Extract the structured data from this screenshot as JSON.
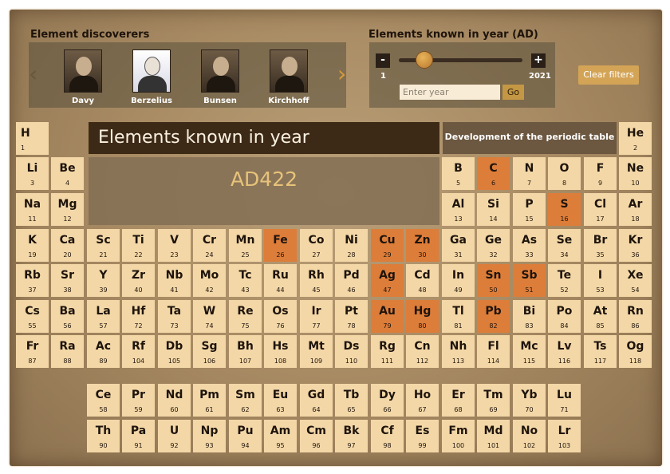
{
  "discoverers": {
    "title": "Element discoverers",
    "items": [
      {
        "name": "Davy",
        "selected": false
      },
      {
        "name": "Berzelius",
        "selected": true
      },
      {
        "name": "Bunsen",
        "selected": false
      },
      {
        "name": "Kirchhoff",
        "selected": false
      }
    ],
    "prev_icon": "chevron-left-icon",
    "next_icon": "chevron-right-icon"
  },
  "year_filter": {
    "title": "Elements known in year (AD)",
    "minus_label": "-",
    "plus_label": "+",
    "min_label": "1",
    "max_label": "2021",
    "input_placeholder": "Enter year",
    "input_value": "",
    "go_label": "Go",
    "slider_value": 422
  },
  "clear_filters_label": "Clear filters",
  "main": {
    "title": "Elements known in year",
    "year_display": "AD422",
    "dev_label": "Development of the periodic table"
  },
  "colors": {
    "known": "#dd7d3a",
    "unknown": "#f3d7a7",
    "title_bar": "#3d2a16"
  },
  "elements": [
    {
      "s": "H",
      "n": "1",
      "known": false
    },
    {
      "s": "He",
      "n": "2",
      "known": false
    },
    {
      "s": "Li",
      "n": "3",
      "known": false
    },
    {
      "s": "Be",
      "n": "4",
      "known": false
    },
    {
      "s": "B",
      "n": "5",
      "known": false
    },
    {
      "s": "C",
      "n": "6",
      "known": true
    },
    {
      "s": "N",
      "n": "7",
      "known": false
    },
    {
      "s": "O",
      "n": "8",
      "known": false
    },
    {
      "s": "F",
      "n": "9",
      "known": false
    },
    {
      "s": "Ne",
      "n": "10",
      "known": false
    },
    {
      "s": "Na",
      "n": "11",
      "known": false
    },
    {
      "s": "Mg",
      "n": "12",
      "known": false
    },
    {
      "s": "Al",
      "n": "13",
      "known": false
    },
    {
      "s": "Si",
      "n": "14",
      "known": false
    },
    {
      "s": "P",
      "n": "15",
      "known": false
    },
    {
      "s": "S",
      "n": "16",
      "known": true
    },
    {
      "s": "Cl",
      "n": "17",
      "known": false
    },
    {
      "s": "Ar",
      "n": "18",
      "known": false
    },
    {
      "s": "K",
      "n": "19",
      "known": false
    },
    {
      "s": "Ca",
      "n": "20",
      "known": false
    },
    {
      "s": "Sc",
      "n": "21",
      "known": false
    },
    {
      "s": "Ti",
      "n": "22",
      "known": false
    },
    {
      "s": "V",
      "n": "23",
      "known": false
    },
    {
      "s": "Cr",
      "n": "24",
      "known": false
    },
    {
      "s": "Mn",
      "n": "25",
      "known": false
    },
    {
      "s": "Fe",
      "n": "26",
      "known": true
    },
    {
      "s": "Co",
      "n": "27",
      "known": false
    },
    {
      "s": "Ni",
      "n": "28",
      "known": false
    },
    {
      "s": "Cu",
      "n": "29",
      "known": true
    },
    {
      "s": "Zn",
      "n": "30",
      "known": true
    },
    {
      "s": "Ga",
      "n": "31",
      "known": false
    },
    {
      "s": "Ge",
      "n": "32",
      "known": false
    },
    {
      "s": "As",
      "n": "33",
      "known": false
    },
    {
      "s": "Se",
      "n": "34",
      "known": false
    },
    {
      "s": "Br",
      "n": "35",
      "known": false
    },
    {
      "s": "Kr",
      "n": "36",
      "known": false
    },
    {
      "s": "Rb",
      "n": "37",
      "known": false
    },
    {
      "s": "Sr",
      "n": "38",
      "known": false
    },
    {
      "s": "Y",
      "n": "39",
      "known": false
    },
    {
      "s": "Zr",
      "n": "40",
      "known": false
    },
    {
      "s": "Nb",
      "n": "41",
      "known": false
    },
    {
      "s": "Mo",
      "n": "42",
      "known": false
    },
    {
      "s": "Tc",
      "n": "43",
      "known": false
    },
    {
      "s": "Ru",
      "n": "44",
      "known": false
    },
    {
      "s": "Rh",
      "n": "45",
      "known": false
    },
    {
      "s": "Pd",
      "n": "46",
      "known": false
    },
    {
      "s": "Ag",
      "n": "47",
      "known": true
    },
    {
      "s": "Cd",
      "n": "48",
      "known": false
    },
    {
      "s": "In",
      "n": "49",
      "known": false
    },
    {
      "s": "Sn",
      "n": "50",
      "known": true
    },
    {
      "s": "Sb",
      "n": "51",
      "known": true
    },
    {
      "s": "Te",
      "n": "52",
      "known": false
    },
    {
      "s": "I",
      "n": "53",
      "known": false
    },
    {
      "s": "Xe",
      "n": "54",
      "known": false
    },
    {
      "s": "Cs",
      "n": "55",
      "known": false
    },
    {
      "s": "Ba",
      "n": "56",
      "known": false
    },
    {
      "s": "La",
      "n": "57",
      "known": false
    },
    {
      "s": "Hf",
      "n": "72",
      "known": false
    },
    {
      "s": "Ta",
      "n": "73",
      "known": false
    },
    {
      "s": "W",
      "n": "74",
      "known": false
    },
    {
      "s": "Re",
      "n": "75",
      "known": false
    },
    {
      "s": "Os",
      "n": "76",
      "known": false
    },
    {
      "s": "Ir",
      "n": "77",
      "known": false
    },
    {
      "s": "Pt",
      "n": "78",
      "known": false
    },
    {
      "s": "Au",
      "n": "79",
      "known": true
    },
    {
      "s": "Hg",
      "n": "80",
      "known": true
    },
    {
      "s": "Tl",
      "n": "81",
      "known": false
    },
    {
      "s": "Pb",
      "n": "82",
      "known": true
    },
    {
      "s": "Bi",
      "n": "83",
      "known": false
    },
    {
      "s": "Po",
      "n": "84",
      "known": false
    },
    {
      "s": "At",
      "n": "85",
      "known": false
    },
    {
      "s": "Rn",
      "n": "86",
      "known": false
    },
    {
      "s": "Fr",
      "n": "87",
      "known": false
    },
    {
      "s": "Ra",
      "n": "88",
      "known": false
    },
    {
      "s": "Ac",
      "n": "89",
      "known": false
    },
    {
      "s": "Rf",
      "n": "104",
      "known": false
    },
    {
      "s": "Db",
      "n": "105",
      "known": false
    },
    {
      "s": "Sg",
      "n": "106",
      "known": false
    },
    {
      "s": "Bh",
      "n": "107",
      "known": false
    },
    {
      "s": "Hs",
      "n": "108",
      "known": false
    },
    {
      "s": "Mt",
      "n": "109",
      "known": false
    },
    {
      "s": "Ds",
      "n": "110",
      "known": false
    },
    {
      "s": "Rg",
      "n": "111",
      "known": false
    },
    {
      "s": "Cn",
      "n": "112",
      "known": false
    },
    {
      "s": "Nh",
      "n": "113",
      "known": false
    },
    {
      "s": "Fl",
      "n": "114",
      "known": false
    },
    {
      "s": "Mc",
      "n": "115",
      "known": false
    },
    {
      "s": "Lv",
      "n": "116",
      "known": false
    },
    {
      "s": "Ts",
      "n": "117",
      "known": false
    },
    {
      "s": "Og",
      "n": "118",
      "known": false
    },
    {
      "s": "Ce",
      "n": "58",
      "known": false
    },
    {
      "s": "Pr",
      "n": "59",
      "known": false
    },
    {
      "s": "Nd",
      "n": "60",
      "known": false
    },
    {
      "s": "Pm",
      "n": "61",
      "known": false
    },
    {
      "s": "Sm",
      "n": "62",
      "known": false
    },
    {
      "s": "Eu",
      "n": "63",
      "known": false
    },
    {
      "s": "Gd",
      "n": "64",
      "known": false
    },
    {
      "s": "Tb",
      "n": "65",
      "known": false
    },
    {
      "s": "Dy",
      "n": "66",
      "known": false
    },
    {
      "s": "Ho",
      "n": "67",
      "known": false
    },
    {
      "s": "Er",
      "n": "68",
      "known": false
    },
    {
      "s": "Tm",
      "n": "69",
      "known": false
    },
    {
      "s": "Yb",
      "n": "70",
      "known": false
    },
    {
      "s": "Lu",
      "n": "71",
      "known": false
    },
    {
      "s": "Th",
      "n": "90",
      "known": false
    },
    {
      "s": "Pa",
      "n": "91",
      "known": false
    },
    {
      "s": "U",
      "n": "92",
      "known": false
    },
    {
      "s": "Np",
      "n": "93",
      "known": false
    },
    {
      "s": "Pu",
      "n": "94",
      "known": false
    },
    {
      "s": "Am",
      "n": "95",
      "known": false
    },
    {
      "s": "Cm",
      "n": "96",
      "known": false
    },
    {
      "s": "Bk",
      "n": "97",
      "known": false
    },
    {
      "s": "Cf",
      "n": "98",
      "known": false
    },
    {
      "s": "Es",
      "n": "99",
      "known": false
    },
    {
      "s": "Fm",
      "n": "100",
      "known": false
    },
    {
      "s": "Md",
      "n": "101",
      "known": false
    },
    {
      "s": "No",
      "n": "102",
      "known": false
    },
    {
      "s": "Lr",
      "n": "103",
      "known": false
    }
  ]
}
